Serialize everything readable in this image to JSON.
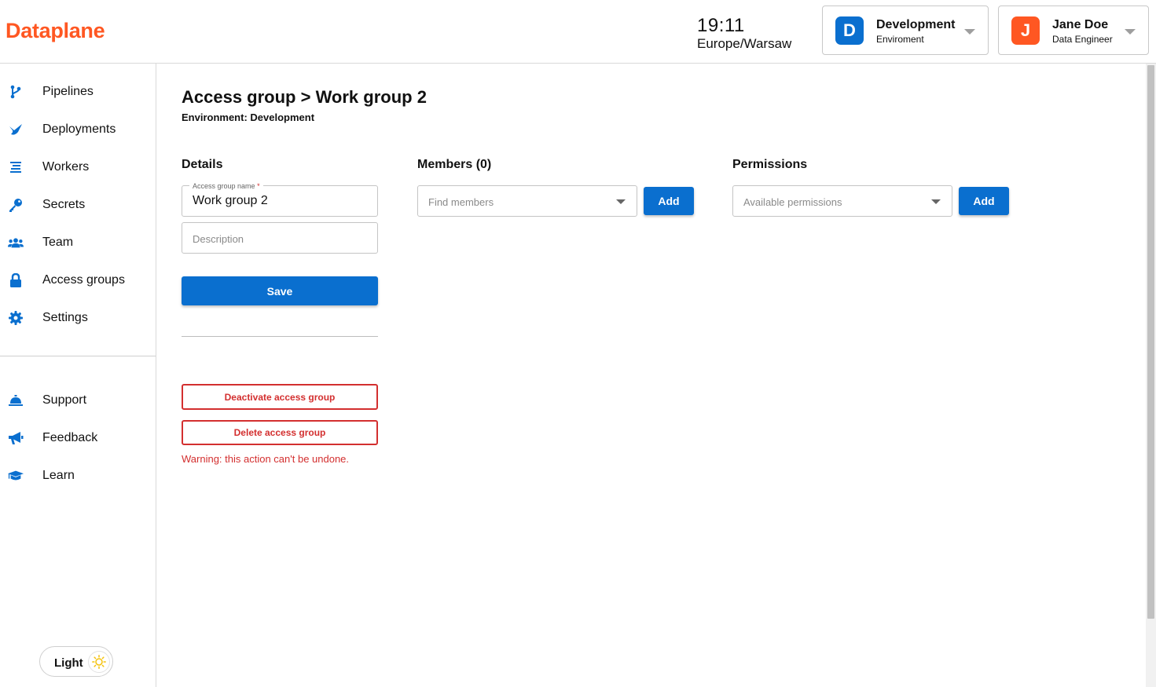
{
  "brand": {
    "logo": "Dataplane",
    "accent_color": "#ff5722",
    "primary_color": "#0a6fcf",
    "danger_color": "#d32f2f"
  },
  "header": {
    "time": "19:11",
    "timezone": "Europe/Warsaw",
    "environment": {
      "badge": "D",
      "title": "Development",
      "subtitle": "Enviroment"
    },
    "user": {
      "badge": "J",
      "name": "Jane Doe",
      "role": "Data Engineer"
    }
  },
  "sidebar": {
    "items": [
      {
        "label": "Pipelines",
        "icon": "pipeline-icon"
      },
      {
        "label": "Deployments",
        "icon": "deployments-icon"
      },
      {
        "label": "Workers",
        "icon": "workers-icon"
      },
      {
        "label": "Secrets",
        "icon": "key-icon"
      },
      {
        "label": "Team",
        "icon": "team-icon"
      },
      {
        "label": "Access groups",
        "icon": "lock-icon"
      },
      {
        "label": "Settings",
        "icon": "gear-icon"
      }
    ],
    "secondary": [
      {
        "label": "Support",
        "icon": "support-bell-icon"
      },
      {
        "label": "Feedback",
        "icon": "megaphone-icon"
      },
      {
        "label": "Learn",
        "icon": "graduation-cap-icon"
      }
    ],
    "theme_toggle": {
      "label": "Light",
      "icon": "sun-icon"
    }
  },
  "main": {
    "title": "Access group > Work group 2",
    "environment_line": "Environment: Development",
    "details": {
      "heading": "Details",
      "name_label": "Access group name",
      "name_required": "*",
      "name_value": "Work group 2",
      "description_placeholder": "Description",
      "save_label": "Save",
      "deactivate_label": "Deactivate access group",
      "delete_label": "Delete access group",
      "warning": "Warning: this action can't be undone."
    },
    "members": {
      "heading": "Members (0)",
      "placeholder": "Find members",
      "add_label": "Add"
    },
    "permissions": {
      "heading": "Permissions",
      "placeholder": "Available permissions",
      "add_label": "Add"
    }
  }
}
